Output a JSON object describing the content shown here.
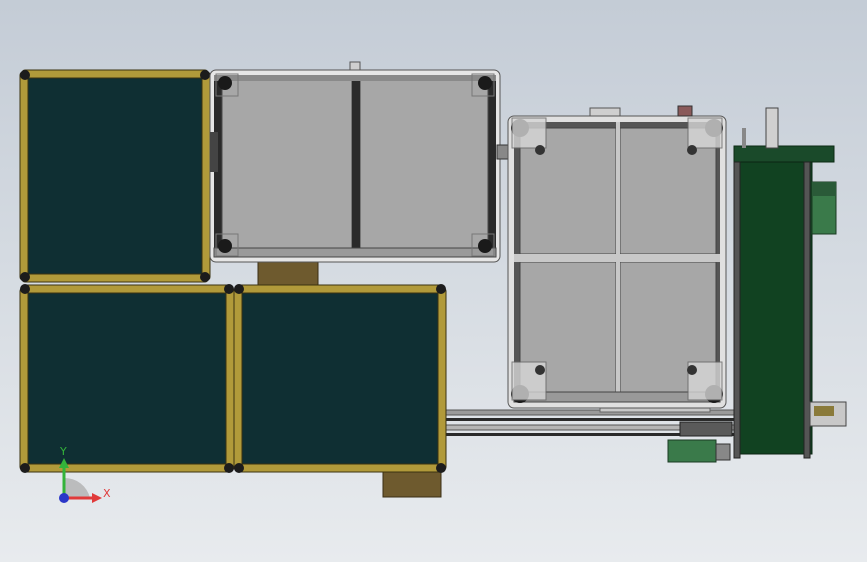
{
  "viewport": {
    "background_top": "#c4ccd6",
    "background_bottom": "#e8ebee"
  },
  "colors": {
    "panel_dark": "#0f2f33",
    "tube_yellow": "#b19a3a",
    "frame_gray": "#a7a7a7",
    "frame_edge": "#4a4a4a",
    "aluminium": "#d9d9d9",
    "conveyor_green": "#114221",
    "motor_green": "#3a7a4a",
    "base_brown": "#6e5a2e",
    "axis_x": "#e03a3a",
    "axis_y": "#33b33a",
    "axis_z": "#2a36c8"
  },
  "triad": {
    "x_label": "X",
    "y_label": "Y"
  }
}
